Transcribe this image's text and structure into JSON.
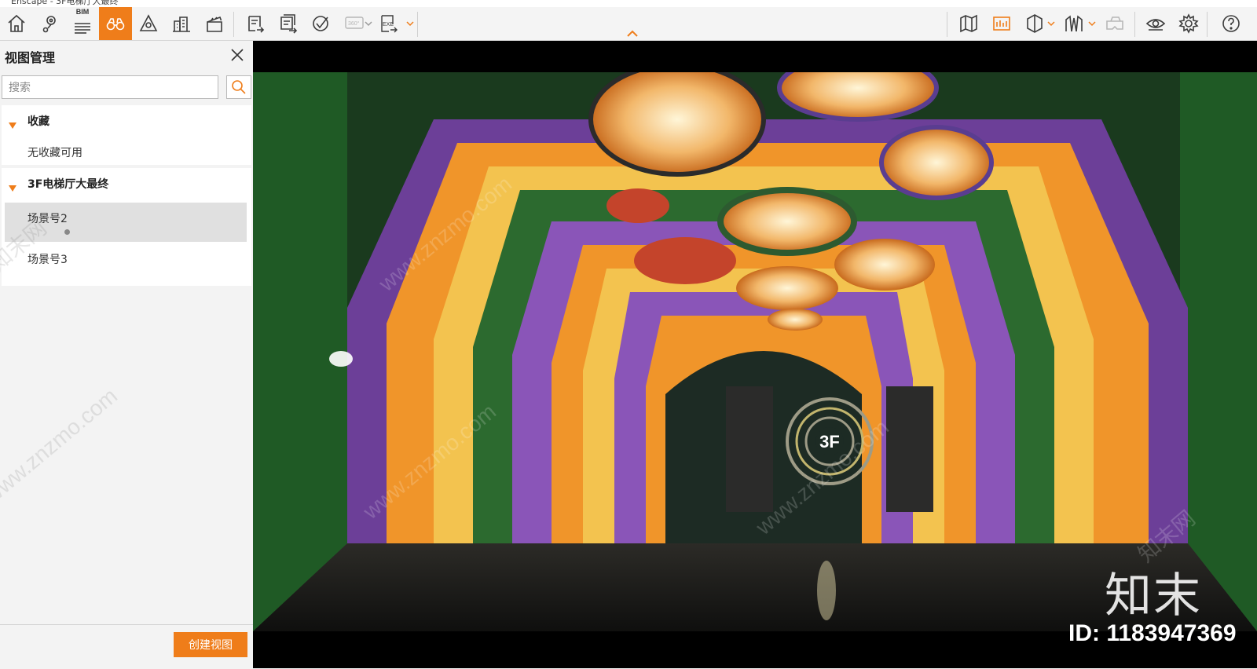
{
  "window": {
    "title": "Enscape - 3F电梯厅大最终"
  },
  "toolbar": {
    "bim_label": "BIM",
    "left_tools": [
      {
        "name": "home-icon"
      },
      {
        "name": "location-icon"
      },
      {
        "name": "bim-list-icon"
      },
      {
        "name": "binoculars-icon",
        "active": true
      },
      {
        "name": "scene-icon"
      },
      {
        "name": "buildings-icon"
      },
      {
        "name": "clapper-icon"
      }
    ],
    "export_tools": [
      {
        "name": "export-image-icon"
      },
      {
        "name": "batch-export-icon"
      },
      {
        "name": "web-export-icon"
      },
      {
        "name": "panorama-360-icon",
        "disabled": true
      },
      {
        "name": "exe-export-icon"
      }
    ],
    "right_tools": [
      {
        "name": "map-icon"
      },
      {
        "name": "asset-library-icon",
        "accent": true
      },
      {
        "name": "section-icon"
      },
      {
        "name": "walkthrough-icon"
      },
      {
        "name": "vr-headset-icon",
        "disabled": true
      },
      {
        "name": "eye-icon"
      },
      {
        "name": "settings-gear-icon"
      },
      {
        "name": "help-icon"
      }
    ],
    "accent_color": "#ef7d1a"
  },
  "sidebar": {
    "title": "视图管理",
    "search_placeholder": "搜索",
    "groups": [
      {
        "title": "收藏",
        "empty_text": "无收藏可用"
      },
      {
        "title": "3F电梯厅大最终",
        "items": [
          {
            "label": "场景号2",
            "selected": true
          },
          {
            "label": "场景号3",
            "selected": false
          }
        ]
      }
    ],
    "create_button": "创建视图"
  },
  "viewport": {
    "watermark_logo": "知末",
    "watermark_id": "ID: 1183947369",
    "watermark_url": "www.znzmo.com",
    "watermark_site": "知末网",
    "elevator_sign": "3F"
  }
}
